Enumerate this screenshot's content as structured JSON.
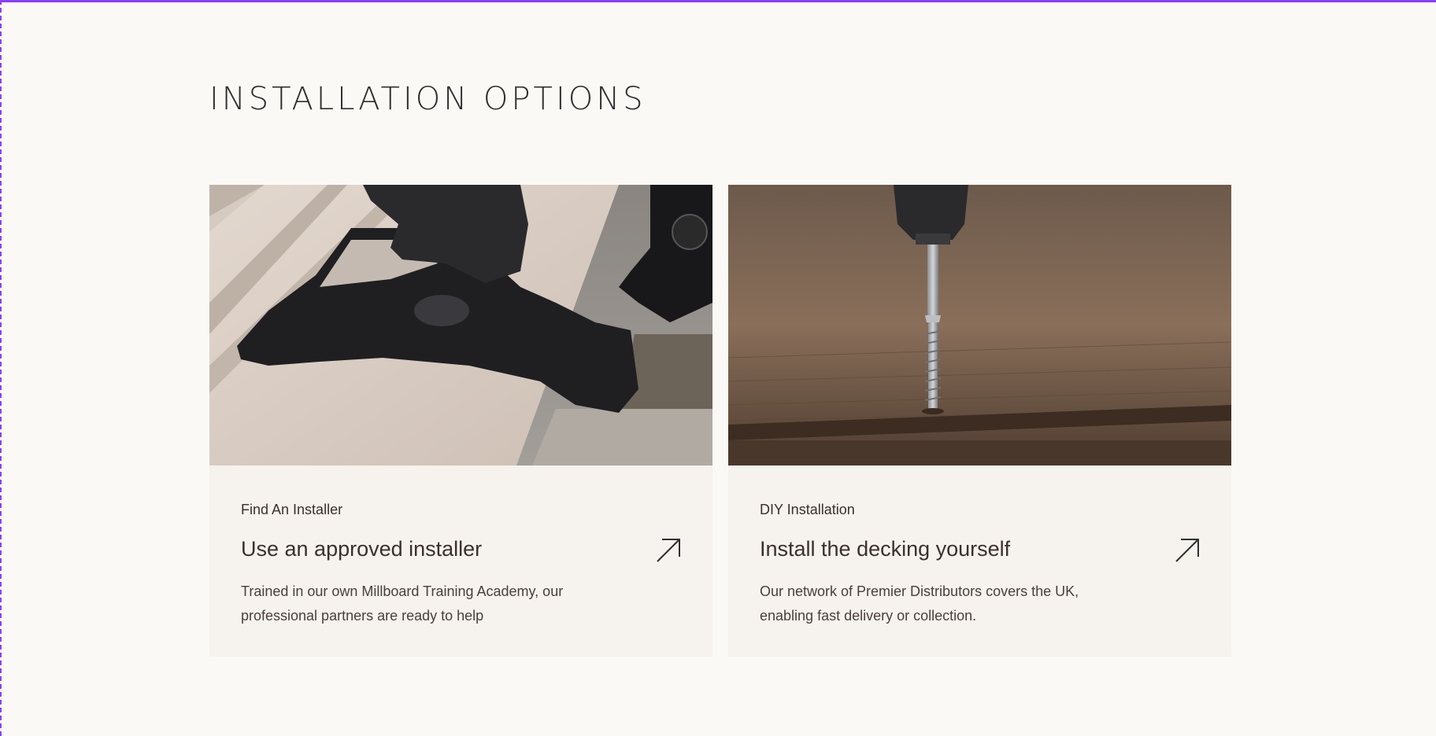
{
  "section": {
    "title": "INSTALLATION OPTIONS"
  },
  "cards": [
    {
      "kicker": "Find An Installer",
      "heading": "Use an approved installer",
      "text": "Trained in our own Millboard Training Academy, our professional partners are ready to help",
      "image_icon": "installer-tool-photo",
      "arrow_icon": "arrow-up-right-icon"
    },
    {
      "kicker": "DIY Installation",
      "heading": "Install the decking yourself",
      "text": "Our network of Premier Distributors covers the UK, enabling fast delivery or collection.",
      "image_icon": "screw-into-decking-photo",
      "arrow_icon": "arrow-up-right-icon"
    }
  ],
  "colors": {
    "page_background": "#fbf9f6",
    "card_background": "#f6f2ed",
    "text": "#3b302c",
    "frame_accent": "#8a3ffc"
  }
}
